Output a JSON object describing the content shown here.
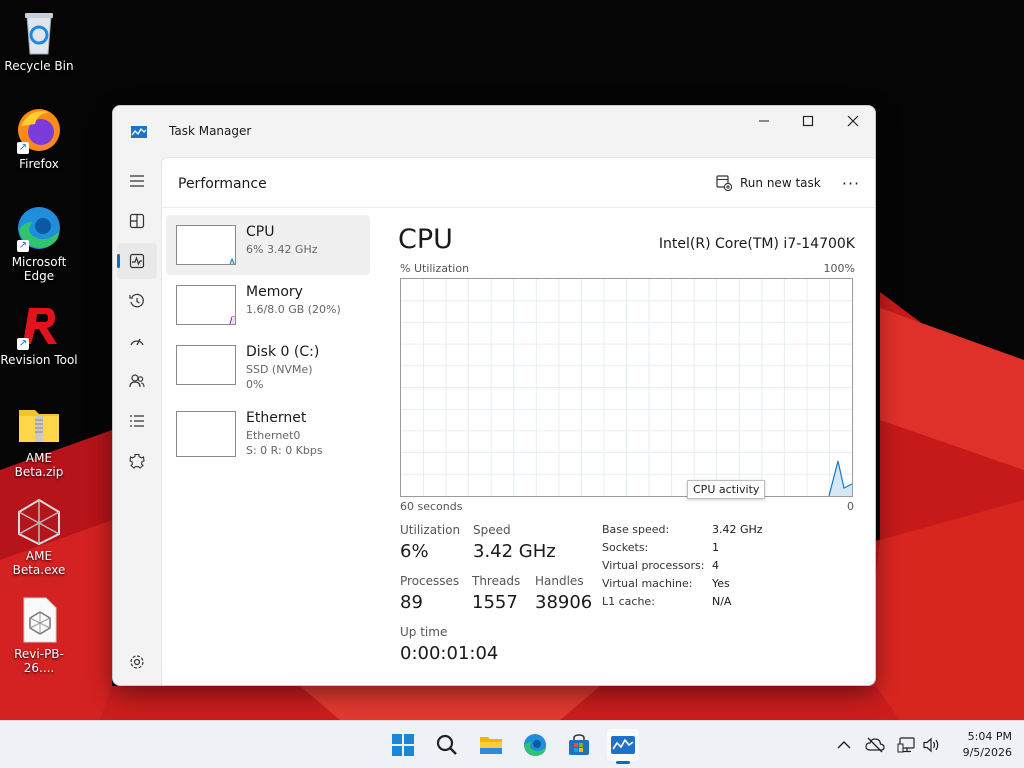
{
  "desktop": {
    "icons": [
      {
        "label": "Recycle Bin",
        "icon": "recycle-bin-icon"
      },
      {
        "label": "Firefox",
        "icon": "firefox-icon"
      },
      {
        "label": "Microsoft Edge",
        "icon": "edge-icon"
      },
      {
        "label": "Revision Tool",
        "icon": "revision-tool-icon"
      },
      {
        "label": "AME Beta.zip",
        "icon": "zip-folder-icon"
      },
      {
        "label": "AME Beta.exe",
        "icon": "ame-exe-icon"
      },
      {
        "label": "Revi-PB-26....",
        "icon": "revi-file-icon"
      }
    ]
  },
  "window": {
    "title": "Task Manager",
    "controls": {
      "minimize": "minimize-icon",
      "maximize": "maximize-icon",
      "close": "close-icon"
    }
  },
  "nav": {
    "items": [
      "hamburger-icon",
      "processes-icon",
      "performance-icon",
      "app-history-icon",
      "startup-apps-icon",
      "users-icon",
      "details-icon",
      "services-icon"
    ],
    "active": "performance-icon",
    "settings": "settings-icon"
  },
  "header": {
    "title": "Performance",
    "run_new_task": "Run new task",
    "more": "···"
  },
  "resources": [
    {
      "name": "CPU",
      "line1": "6% 3.42 GHz",
      "line2": "",
      "selected": true
    },
    {
      "name": "Memory",
      "line1": "1.6/8.0 GB (20%)",
      "line2": ""
    },
    {
      "name": "Disk 0 (C:)",
      "line1": "SSD (NVMe)",
      "line2": "0%"
    },
    {
      "name": "Ethernet",
      "line1": "Ethernet0",
      "line2": "S: 0 R: 0 Kbps"
    }
  ],
  "cpu": {
    "title": "CPU",
    "model": "Intel(R) Core(TM) i7-14700K",
    "util_label": "% Utilization",
    "max_label": "100%",
    "time_label": "60 seconds",
    "min_label": "0",
    "tooltip": "CPU activity",
    "graph_color": "#117dbb",
    "stats": {
      "utilization_label": "Utilization",
      "utilization": "6%",
      "speed_label": "Speed",
      "speed": "3.42 GHz",
      "processes_label": "Processes",
      "processes": "89",
      "threads_label": "Threads",
      "threads": "1557",
      "handles_label": "Handles",
      "handles": "38906",
      "uptime_label": "Up time",
      "uptime": "0:00:01:04"
    },
    "specs": [
      {
        "label": "Base speed:",
        "value": "3.42 GHz"
      },
      {
        "label": "Sockets:",
        "value": "1"
      },
      {
        "label": "Virtual processors:",
        "value": "4"
      },
      {
        "label": "Virtual machine:",
        "value": "Yes"
      },
      {
        "label": "L1 cache:",
        "value": "N/A"
      }
    ]
  },
  "taskbar": {
    "apps": [
      "start-icon",
      "search-icon",
      "file-explorer-icon",
      "edge-icon",
      "store-icon",
      "task-manager-icon"
    ],
    "active": "task-manager-icon",
    "tray": [
      "chevron-up-icon",
      "cloud-offline-icon",
      "network-icon",
      "volume-icon"
    ],
    "time": "5:04 PM",
    "date": "9/5/2026"
  }
}
